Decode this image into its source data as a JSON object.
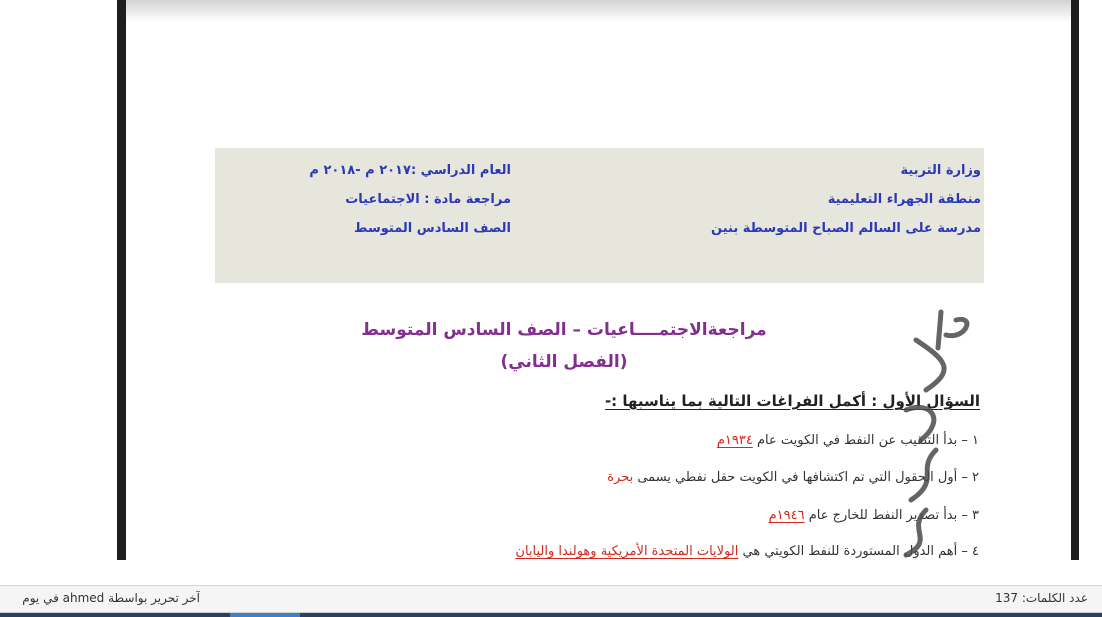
{
  "document": {
    "header": {
      "right_lines": [
        "وزارة التربية",
        "منطقة الجهراء التعليمية",
        "مدرسة على السالم الصباح المتوسطة بنين"
      ],
      "left_lines": [
        "العام الدراسي :٢٠١٧ م -٢٠١٨ م",
        "مراجعة مادة : الاجتماعيات",
        "الصف السادس المتوسط"
      ]
    },
    "title_line1": "مراجعةالاجتمــــاعيات – الصف السادس المتوسط",
    "title_line2": "(الفصل الثاني)",
    "question_heading": "السؤال الأول : أكمل الفراغات التالية بما يناسبها :-",
    "items": [
      {
        "text": "١ – بدأ التنقيب عن النفط في الكويت عام ",
        "answer": "١٩٣٤م"
      },
      {
        "text": "٢ – أول الحقول التي تم اكتشافها في الكويت حقل نفطي يسمى ",
        "answer": "بحرة"
      },
      {
        "text": "٣ – بدأ تصدير النفط للخارج عام ",
        "answer": "١٩٤٦م"
      },
      {
        "text": "٤ – أهم الدول المستوردة للنفط الكويتي هي ",
        "answer": "الولايات المتحدة الأمريكية وهولندا واليابان"
      }
    ],
    "watermark": "مدرسة"
  },
  "status_bar": {
    "word_count": "عدد الكلمات: 137",
    "last_edited": "آخر تحرير بواسطة ahmed في يوم"
  },
  "colors": {
    "header_bg": "#e7e6dd",
    "header_text": "#2b39b4",
    "title": "#82308e",
    "answer": "#d4271e"
  }
}
